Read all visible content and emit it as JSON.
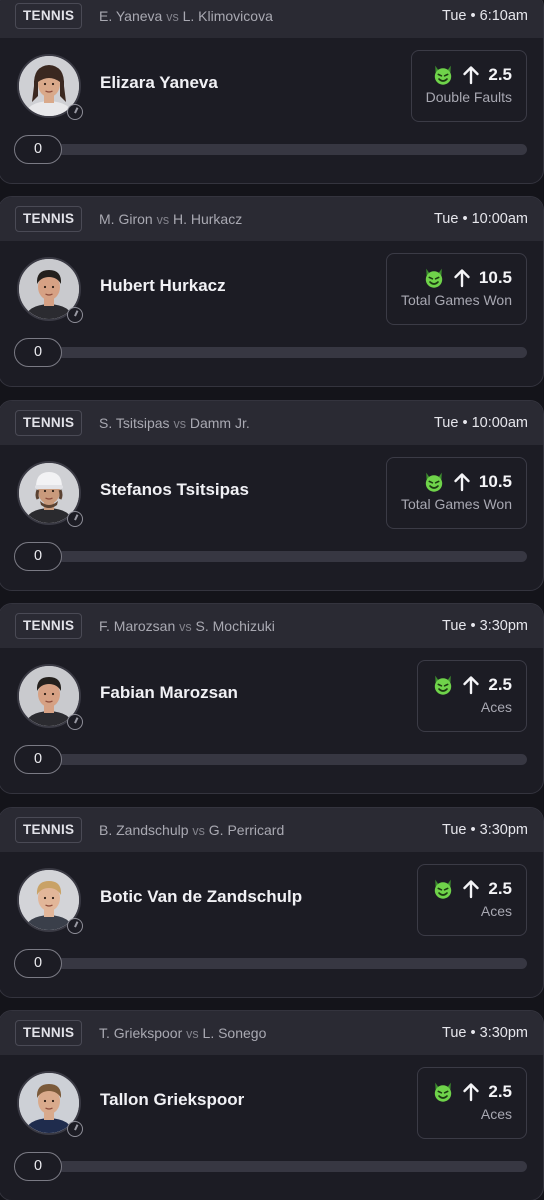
{
  "icons": {
    "tier": "green-demon-icon",
    "direction": "arrow-up-icon",
    "status": "clock-icon"
  },
  "colors": {
    "background": "#14141a",
    "card": "#1c1c24",
    "header": "#2a2a33",
    "accent_green": "#6fd34a"
  },
  "picks": [
    {
      "sport": "TENNIS",
      "player1": "E. Yaneva",
      "vs": "vs",
      "player2": "L. Klimovicova",
      "time": "Tue • 6:10am",
      "player_name": "Elizara Yaneva",
      "line": "2.5",
      "stat": "Double Faults",
      "current_value": "0",
      "progress": 0,
      "avatar": "female"
    },
    {
      "sport": "TENNIS",
      "player1": "M. Giron",
      "vs": "vs",
      "player2": "H. Hurkacz",
      "time": "Tue • 10:00am",
      "player_name": "Hubert Hurkacz",
      "line": "10.5",
      "stat": "Total Games Won",
      "current_value": "0",
      "progress": 0,
      "avatar": "male-dark"
    },
    {
      "sport": "TENNIS",
      "player1": "S. Tsitsipas",
      "vs": "vs",
      "player2": "Damm Jr.",
      "time": "Tue • 10:00am",
      "player_name": "Stefanos Tsitsipas",
      "line": "10.5",
      "stat": "Total Games Won",
      "current_value": "0",
      "progress": 0,
      "avatar": "male-cap"
    },
    {
      "sport": "TENNIS",
      "player1": "F. Marozsan",
      "vs": "vs",
      "player2": "S. Mochizuki",
      "time": "Tue • 3:30pm",
      "player_name": "Fabian Marozsan",
      "line": "2.5",
      "stat": "Aces",
      "current_value": "0",
      "progress": 0,
      "avatar": "male-dark"
    },
    {
      "sport": "TENNIS",
      "player1": "B. Zandschulp",
      "vs": "vs",
      "player2": "G. Perricard",
      "time": "Tue • 3:30pm",
      "player_name": "Botic Van de Zandschulp",
      "line": "2.5",
      "stat": "Aces",
      "current_value": "0",
      "progress": 0,
      "avatar": "male-blond"
    },
    {
      "sport": "TENNIS",
      "player1": "T. Griekspoor",
      "vs": "vs",
      "player2": "L. Sonego",
      "time": "Tue • 3:30pm",
      "player_name": "Tallon Griekspoor",
      "line": "2.5",
      "stat": "Aces",
      "current_value": "0",
      "progress": 0,
      "avatar": "male-navy"
    }
  ]
}
